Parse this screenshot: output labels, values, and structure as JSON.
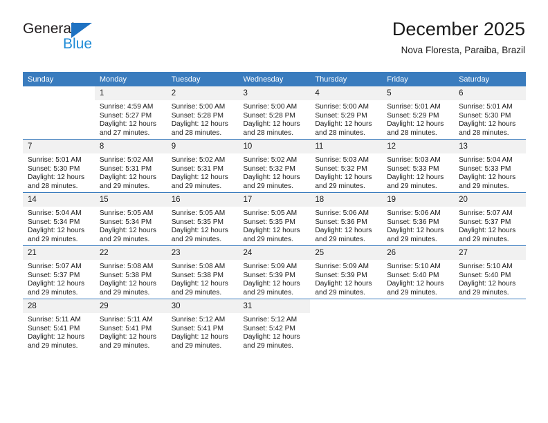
{
  "brand": {
    "name_top": "General",
    "name_bottom": "Blue",
    "triangle_icon": "blue-triangle-icon",
    "accent_color": "#1F72C2",
    "blue_text_color": "#1F8BD6"
  },
  "header": {
    "title": "December 2025",
    "subtitle": "Nova Floresta, Paraiba, Brazil"
  },
  "theme": {
    "header_bg": "#3A7CBE",
    "header_text": "#FFFFFF",
    "daynum_bg": "#F1F1F1",
    "divider": "#3A7CBE"
  },
  "weekday_headers": [
    "Sunday",
    "Monday",
    "Tuesday",
    "Wednesday",
    "Thursday",
    "Friday",
    "Saturday"
  ],
  "weeks": [
    [
      {
        "day": "",
        "sunrise": "",
        "sunset": "",
        "daylight_line1": "",
        "daylight_line2": "",
        "blank": true
      },
      {
        "day": "1",
        "sunrise": "Sunrise: 4:59 AM",
        "sunset": "Sunset: 5:27 PM",
        "daylight_line1": "Daylight: 12 hours",
        "daylight_line2": "and 27 minutes."
      },
      {
        "day": "2",
        "sunrise": "Sunrise: 5:00 AM",
        "sunset": "Sunset: 5:28 PM",
        "daylight_line1": "Daylight: 12 hours",
        "daylight_line2": "and 28 minutes."
      },
      {
        "day": "3",
        "sunrise": "Sunrise: 5:00 AM",
        "sunset": "Sunset: 5:28 PM",
        "daylight_line1": "Daylight: 12 hours",
        "daylight_line2": "and 28 minutes."
      },
      {
        "day": "4",
        "sunrise": "Sunrise: 5:00 AM",
        "sunset": "Sunset: 5:29 PM",
        "daylight_line1": "Daylight: 12 hours",
        "daylight_line2": "and 28 minutes."
      },
      {
        "day": "5",
        "sunrise": "Sunrise: 5:01 AM",
        "sunset": "Sunset: 5:29 PM",
        "daylight_line1": "Daylight: 12 hours",
        "daylight_line2": "and 28 minutes."
      },
      {
        "day": "6",
        "sunrise": "Sunrise: 5:01 AM",
        "sunset": "Sunset: 5:30 PM",
        "daylight_line1": "Daylight: 12 hours",
        "daylight_line2": "and 28 minutes."
      }
    ],
    [
      {
        "day": "7",
        "sunrise": "Sunrise: 5:01 AM",
        "sunset": "Sunset: 5:30 PM",
        "daylight_line1": "Daylight: 12 hours",
        "daylight_line2": "and 28 minutes."
      },
      {
        "day": "8",
        "sunrise": "Sunrise: 5:02 AM",
        "sunset": "Sunset: 5:31 PM",
        "daylight_line1": "Daylight: 12 hours",
        "daylight_line2": "and 29 minutes."
      },
      {
        "day": "9",
        "sunrise": "Sunrise: 5:02 AM",
        "sunset": "Sunset: 5:31 PM",
        "daylight_line1": "Daylight: 12 hours",
        "daylight_line2": "and 29 minutes."
      },
      {
        "day": "10",
        "sunrise": "Sunrise: 5:02 AM",
        "sunset": "Sunset: 5:32 PM",
        "daylight_line1": "Daylight: 12 hours",
        "daylight_line2": "and 29 minutes."
      },
      {
        "day": "11",
        "sunrise": "Sunrise: 5:03 AM",
        "sunset": "Sunset: 5:32 PM",
        "daylight_line1": "Daylight: 12 hours",
        "daylight_line2": "and 29 minutes."
      },
      {
        "day": "12",
        "sunrise": "Sunrise: 5:03 AM",
        "sunset": "Sunset: 5:33 PM",
        "daylight_line1": "Daylight: 12 hours",
        "daylight_line2": "and 29 minutes."
      },
      {
        "day": "13",
        "sunrise": "Sunrise: 5:04 AM",
        "sunset": "Sunset: 5:33 PM",
        "daylight_line1": "Daylight: 12 hours",
        "daylight_line2": "and 29 minutes."
      }
    ],
    [
      {
        "day": "14",
        "sunrise": "Sunrise: 5:04 AM",
        "sunset": "Sunset: 5:34 PM",
        "daylight_line1": "Daylight: 12 hours",
        "daylight_line2": "and 29 minutes."
      },
      {
        "day": "15",
        "sunrise": "Sunrise: 5:05 AM",
        "sunset": "Sunset: 5:34 PM",
        "daylight_line1": "Daylight: 12 hours",
        "daylight_line2": "and 29 minutes."
      },
      {
        "day": "16",
        "sunrise": "Sunrise: 5:05 AM",
        "sunset": "Sunset: 5:35 PM",
        "daylight_line1": "Daylight: 12 hours",
        "daylight_line2": "and 29 minutes."
      },
      {
        "day": "17",
        "sunrise": "Sunrise: 5:05 AM",
        "sunset": "Sunset: 5:35 PM",
        "daylight_line1": "Daylight: 12 hours",
        "daylight_line2": "and 29 minutes."
      },
      {
        "day": "18",
        "sunrise": "Sunrise: 5:06 AM",
        "sunset": "Sunset: 5:36 PM",
        "daylight_line1": "Daylight: 12 hours",
        "daylight_line2": "and 29 minutes."
      },
      {
        "day": "19",
        "sunrise": "Sunrise: 5:06 AM",
        "sunset": "Sunset: 5:36 PM",
        "daylight_line1": "Daylight: 12 hours",
        "daylight_line2": "and 29 minutes."
      },
      {
        "day": "20",
        "sunrise": "Sunrise: 5:07 AM",
        "sunset": "Sunset: 5:37 PM",
        "daylight_line1": "Daylight: 12 hours",
        "daylight_line2": "and 29 minutes."
      }
    ],
    [
      {
        "day": "21",
        "sunrise": "Sunrise: 5:07 AM",
        "sunset": "Sunset: 5:37 PM",
        "daylight_line1": "Daylight: 12 hours",
        "daylight_line2": "and 29 minutes."
      },
      {
        "day": "22",
        "sunrise": "Sunrise: 5:08 AM",
        "sunset": "Sunset: 5:38 PM",
        "daylight_line1": "Daylight: 12 hours",
        "daylight_line2": "and 29 minutes."
      },
      {
        "day": "23",
        "sunrise": "Sunrise: 5:08 AM",
        "sunset": "Sunset: 5:38 PM",
        "daylight_line1": "Daylight: 12 hours",
        "daylight_line2": "and 29 minutes."
      },
      {
        "day": "24",
        "sunrise": "Sunrise: 5:09 AM",
        "sunset": "Sunset: 5:39 PM",
        "daylight_line1": "Daylight: 12 hours",
        "daylight_line2": "and 29 minutes."
      },
      {
        "day": "25",
        "sunrise": "Sunrise: 5:09 AM",
        "sunset": "Sunset: 5:39 PM",
        "daylight_line1": "Daylight: 12 hours",
        "daylight_line2": "and 29 minutes."
      },
      {
        "day": "26",
        "sunrise": "Sunrise: 5:10 AM",
        "sunset": "Sunset: 5:40 PM",
        "daylight_line1": "Daylight: 12 hours",
        "daylight_line2": "and 29 minutes."
      },
      {
        "day": "27",
        "sunrise": "Sunrise: 5:10 AM",
        "sunset": "Sunset: 5:40 PM",
        "daylight_line1": "Daylight: 12 hours",
        "daylight_line2": "and 29 minutes."
      }
    ],
    [
      {
        "day": "28",
        "sunrise": "Sunrise: 5:11 AM",
        "sunset": "Sunset: 5:41 PM",
        "daylight_line1": "Daylight: 12 hours",
        "daylight_line2": "and 29 minutes."
      },
      {
        "day": "29",
        "sunrise": "Sunrise: 5:11 AM",
        "sunset": "Sunset: 5:41 PM",
        "daylight_line1": "Daylight: 12 hours",
        "daylight_line2": "and 29 minutes."
      },
      {
        "day": "30",
        "sunrise": "Sunrise: 5:12 AM",
        "sunset": "Sunset: 5:41 PM",
        "daylight_line1": "Daylight: 12 hours",
        "daylight_line2": "and 29 minutes."
      },
      {
        "day": "31",
        "sunrise": "Sunrise: 5:12 AM",
        "sunset": "Sunset: 5:42 PM",
        "daylight_line1": "Daylight: 12 hours",
        "daylight_line2": "and 29 minutes."
      },
      {
        "day": "",
        "sunrise": "",
        "sunset": "",
        "daylight_line1": "",
        "daylight_line2": "",
        "blank": true
      },
      {
        "day": "",
        "sunrise": "",
        "sunset": "",
        "daylight_line1": "",
        "daylight_line2": "",
        "blank": true
      },
      {
        "day": "",
        "sunrise": "",
        "sunset": "",
        "daylight_line1": "",
        "daylight_line2": "",
        "blank": true
      }
    ]
  ]
}
